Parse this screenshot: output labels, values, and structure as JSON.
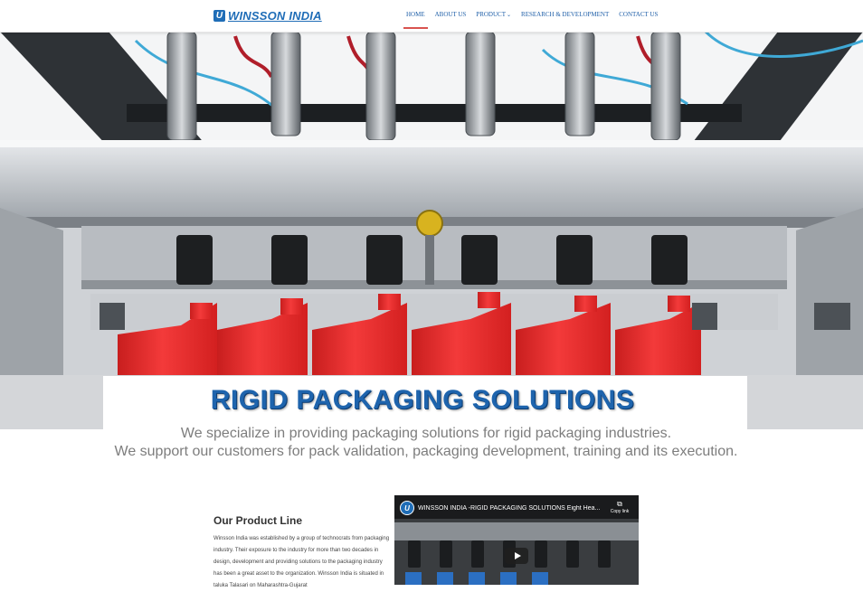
{
  "nav": {
    "brand": "WINSSON INDIA",
    "logo_glyph": "U",
    "items": [
      {
        "label": "HOME",
        "active": true
      },
      {
        "label": "ABOUT US"
      },
      {
        "label": "PRODUCT",
        "dropdown": true
      },
      {
        "label": "RESEARCH & DEVELOPMENT"
      },
      {
        "label": "CONTACT US"
      }
    ]
  },
  "hero": {
    "title": "RIGID PACKAGING SOLUTIONS",
    "tagline_1": "We specialize in providing packaging solutions for rigid packaging industries.",
    "tagline_2": "We support our customers for pack validation, packaging development, training and its execution."
  },
  "product_line": {
    "title": "Our Product Line",
    "body": "Winsson India was established by a group of technocrats from packaging industry. Their exposure to the industry for more than two decades in design, development and providing solutions to the packaging industry has been a great asset to the organization. Winsson India is situated in taluka Talasari on Maharashtra-Gujarat"
  },
  "video": {
    "title": "WINSSON INDIA -RIGID PACKAGING SOLUTIONS Eight Hea...",
    "copy_label": "Copy link",
    "channel_glyph": "U",
    "icons": [
      "copy-icon",
      "play-icon"
    ]
  },
  "colors": {
    "brand_blue": "#1f6db7",
    "title_blue": "#1e64ad",
    "active_underline": "#d9534f",
    "bottle_red": "#ea2b2b",
    "tagline_gray": "#7d7d7d"
  }
}
